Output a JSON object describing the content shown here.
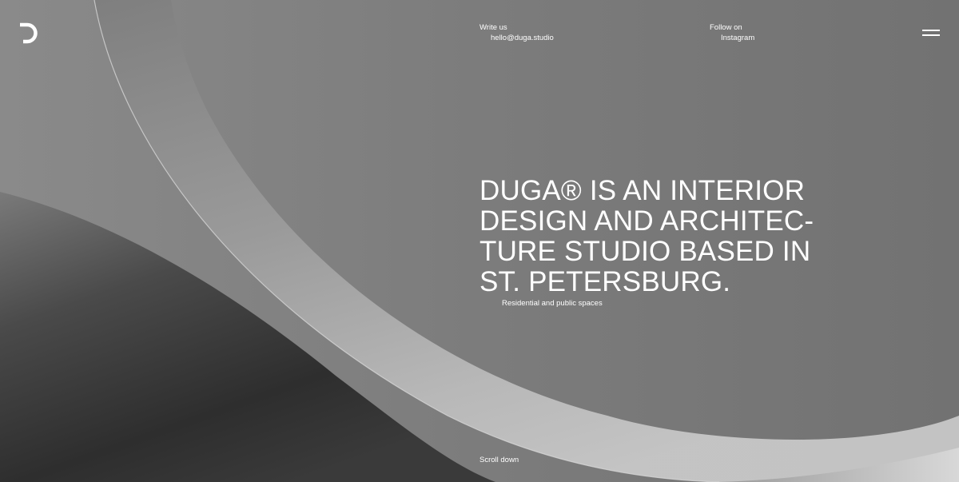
{
  "header": {
    "logo": "duga-logo",
    "write_us": {
      "label": "Write us",
      "email": "hello@duga.studio"
    },
    "follow_on": {
      "label": "Follow on",
      "network": "Instagram"
    },
    "menu_icon": "hamburger-menu-icon"
  },
  "hero": {
    "headline_lines": [
      "DUGA® IS AN INTERIOR",
      "DESIGN AND ARCHITEC-",
      "TURE STUDIO BASED IN",
      "ST. PETERSBURG."
    ],
    "subtitle": "Residential and public spaces",
    "scroll_label": "Scroll down"
  },
  "colors": {
    "text": "#ffffff",
    "background": "#7a7a7a"
  }
}
